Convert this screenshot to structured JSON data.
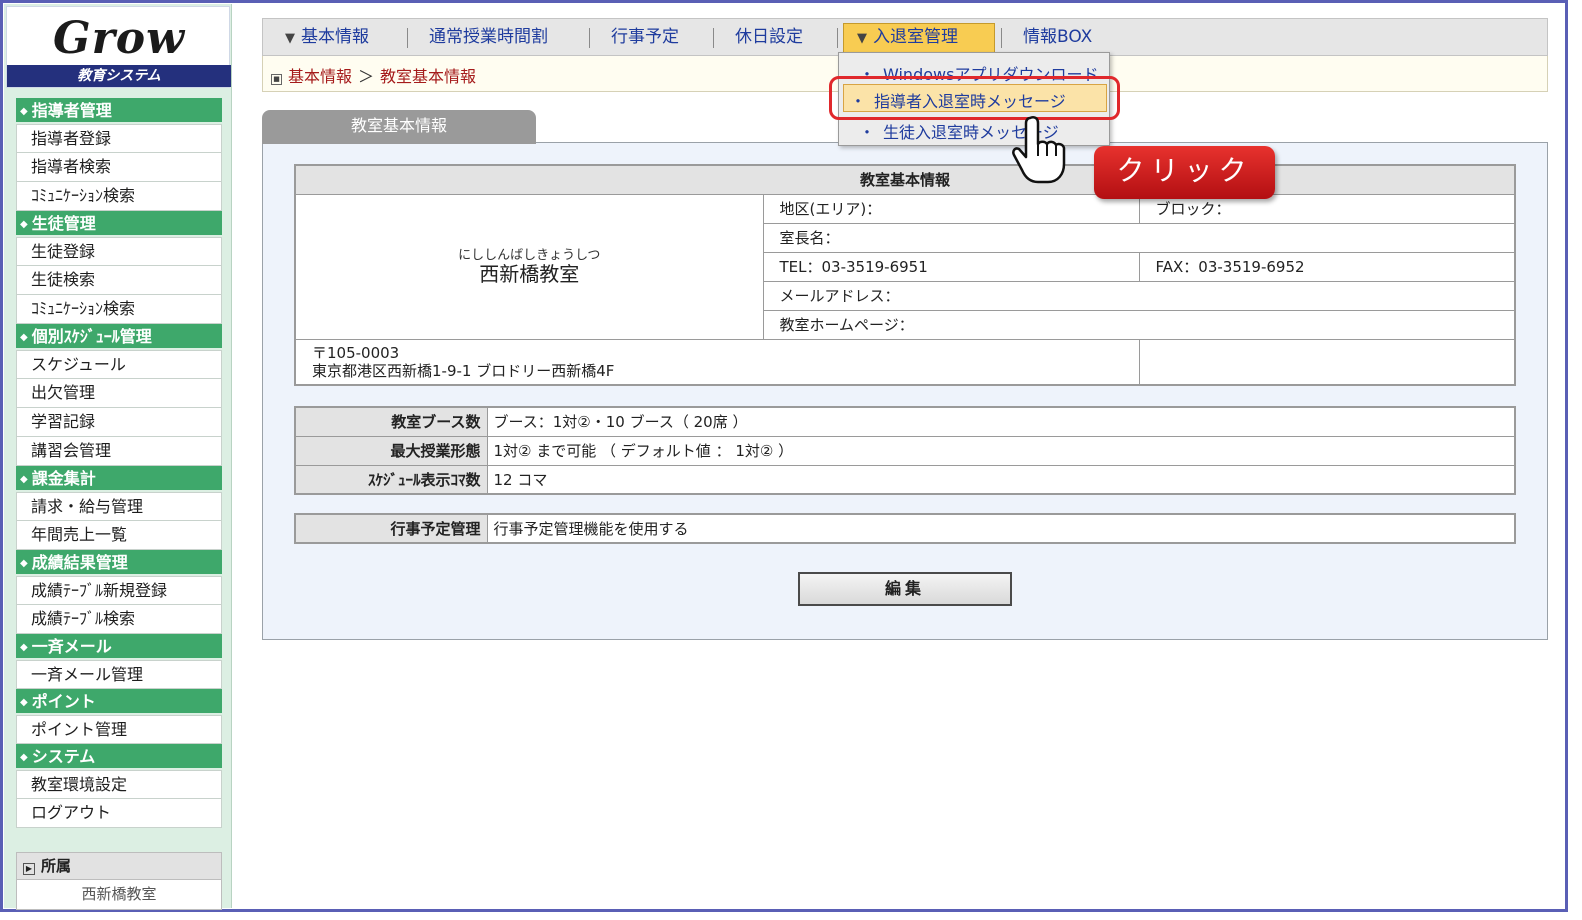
{
  "app": {
    "logo": "Grow",
    "logo_subtitle": "教育システム"
  },
  "sidebar": {
    "sections": [
      {
        "title": "指導者管理",
        "items": [
          "指導者登録",
          "指導者検索",
          "ｺﾐｭﾆｹｰｼｮﾝ検索"
        ]
      },
      {
        "title": "生徒管理",
        "items": [
          "生徒登録",
          "生徒検索",
          "ｺﾐｭﾆｹｰｼｮﾝ検索"
        ]
      },
      {
        "title": "個別ｽｹｼﾞｭｰﾙ管理",
        "items": [
          "スケジュール",
          "出欠管理",
          "学習記録",
          "講習会管理"
        ]
      },
      {
        "title": "課金集計",
        "items": [
          "請求・給与管理",
          "年間売上一覧"
        ]
      },
      {
        "title": "成績結果管理",
        "items": [
          "成績ﾃｰﾌﾞﾙ新規登録",
          "成績ﾃｰﾌﾞﾙ検索"
        ]
      },
      {
        "title": "一斉メール",
        "items": [
          "一斉メール管理"
        ]
      },
      {
        "title": "ポイント",
        "items": [
          "ポイント管理"
        ]
      },
      {
        "title": "システム",
        "items": [
          "教室環境設定",
          "ログアウト"
        ]
      }
    ],
    "affiliation": {
      "label": "所属",
      "value": "西新橋教室"
    }
  },
  "topnav": {
    "items": [
      "基本情報",
      "通常授業時間割",
      "行事予定",
      "休日設定",
      "入退室管理",
      "情報BOX"
    ],
    "active": "入退室管理"
  },
  "dropdown": {
    "items": [
      "Windowsアプリダウンロード",
      "指導者入退室時メッセージ",
      "生徒入退室時メッセージ"
    ],
    "highlighted": "指導者入退室時メッセージ"
  },
  "breadcrumb": {
    "parent": "基本情報",
    "separator": "＞",
    "current": "教室基本情報"
  },
  "tab": {
    "label": "教室基本情報"
  },
  "info": {
    "header": "教室基本情報",
    "school_ruby": "にししんばしきょうしつ",
    "school_name": "西新橋教室",
    "area": "地区(エリア)：",
    "block": "ブロック：",
    "manager": "室長名：",
    "tel": "TEL：03-3519-6951",
    "fax": "FAX：03-3519-6952",
    "email": "メールアドレス：",
    "homepage": "教室ホームページ：",
    "postal": "〒105-0003",
    "address": "東京都港区西新橋1-9-1 ブロドリー西新橋4F"
  },
  "details": [
    {
      "label": "教室ブース数",
      "value": "ブース：1対②・10 ブース（ 20席 ）"
    },
    {
      "label": "最大授業形態",
      "value": "1対② まで可能 （ デフォルト値 ： 1対② ）"
    },
    {
      "label": "ｽｹｼﾞｭｰﾙ表示ｺﾏ数",
      "value": "12 コマ"
    }
  ],
  "events": {
    "label": "行事予定管理",
    "value": "行事予定管理機能を使用する"
  },
  "edit_button": "編集",
  "callout": "クリック",
  "colors": {
    "accent_green": "#3ea86b",
    "nav_active": "#f8cc52",
    "callout_red": "#d3201f",
    "link_blue": "#1f3c9e",
    "breadcrumb_red": "#a51b1b"
  }
}
